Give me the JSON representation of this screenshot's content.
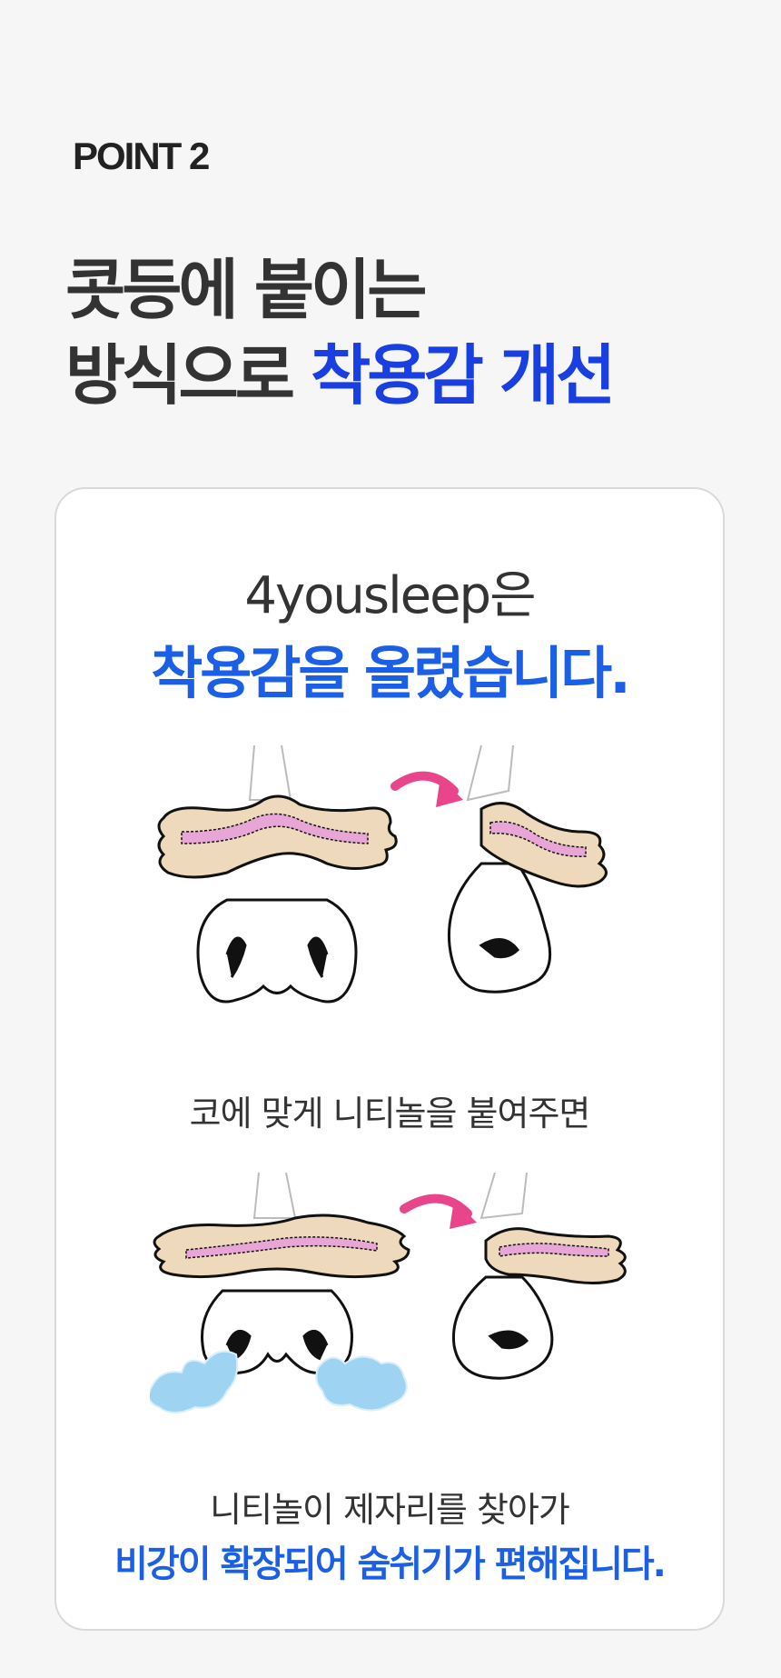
{
  "point_label": "POINT 2",
  "headline": {
    "line1": "콧등에 붙이는",
    "line2_prefix": "방식으로 ",
    "line2_accent": "착용감 개선"
  },
  "card": {
    "title_line1": "4yousleep은",
    "title_line2": "착용감을 올렸습니다.",
    "caption1": "코에 맞게 니티놀을 붙여주면",
    "caption2": "니티놀이 제자리를 찾아가",
    "caption3": "비강이 확장되어 숨쉬기가 편해집니다."
  },
  "colors": {
    "accent_dark_blue": "#1a3fe0",
    "accent_blue": "#1a5fe6",
    "strip_beige": "#efd9bc",
    "strip_pink": "#e8a6d6",
    "arrow_pink": "#e8458a",
    "air_blue": "#9fd3f2"
  }
}
